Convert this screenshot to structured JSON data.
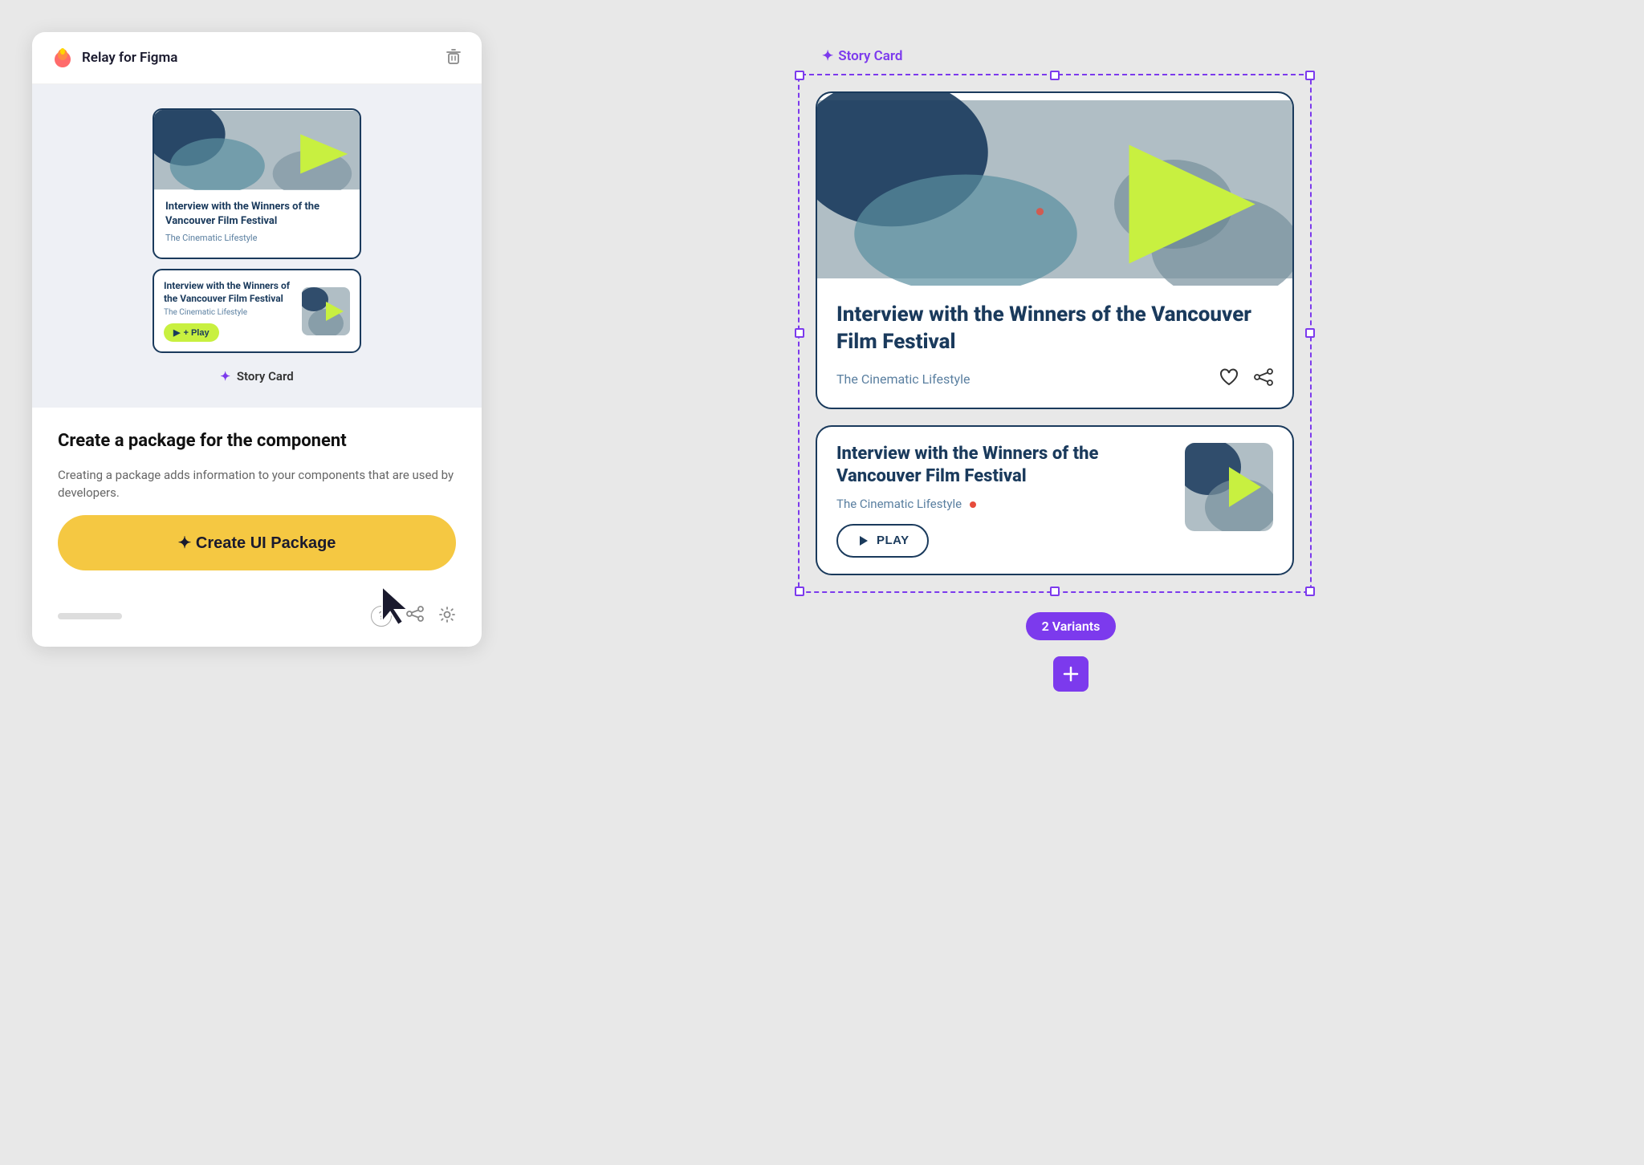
{
  "app": {
    "title": "Relay for Figma",
    "trash_icon": "🗑"
  },
  "left_panel": {
    "card1": {
      "title": "Interview with the Winners of the Vancouver Film Festival",
      "subtitle": "The Cinematic Lifestyle"
    },
    "card2": {
      "title": "Interview with the Winners of the Vancouver Film Festival",
      "subtitle": "The Cinematic Lifestyle",
      "play_label": "+ Play"
    },
    "component_label": "Story Card",
    "create_title": "Create a package for the component",
    "create_desc": "Creating a package adds information to your components that are used by developers.",
    "create_btn": "✦  Create UI Package"
  },
  "right_panel": {
    "label": "Story Card",
    "card_large": {
      "title": "Interview with the Winners of the Vancouver Film Festival",
      "subtitle": "The Cinematic Lifestyle"
    },
    "card_h": {
      "title": "Interview with the Winners of the Vancouver Film Festival",
      "subtitle": "The Cinematic Lifestyle",
      "play_label": "PLAY"
    },
    "variants_badge": "2 Variants"
  },
  "footer": {
    "help_icon": "?",
    "share_icon": "share",
    "settings_icon": "⚙"
  }
}
